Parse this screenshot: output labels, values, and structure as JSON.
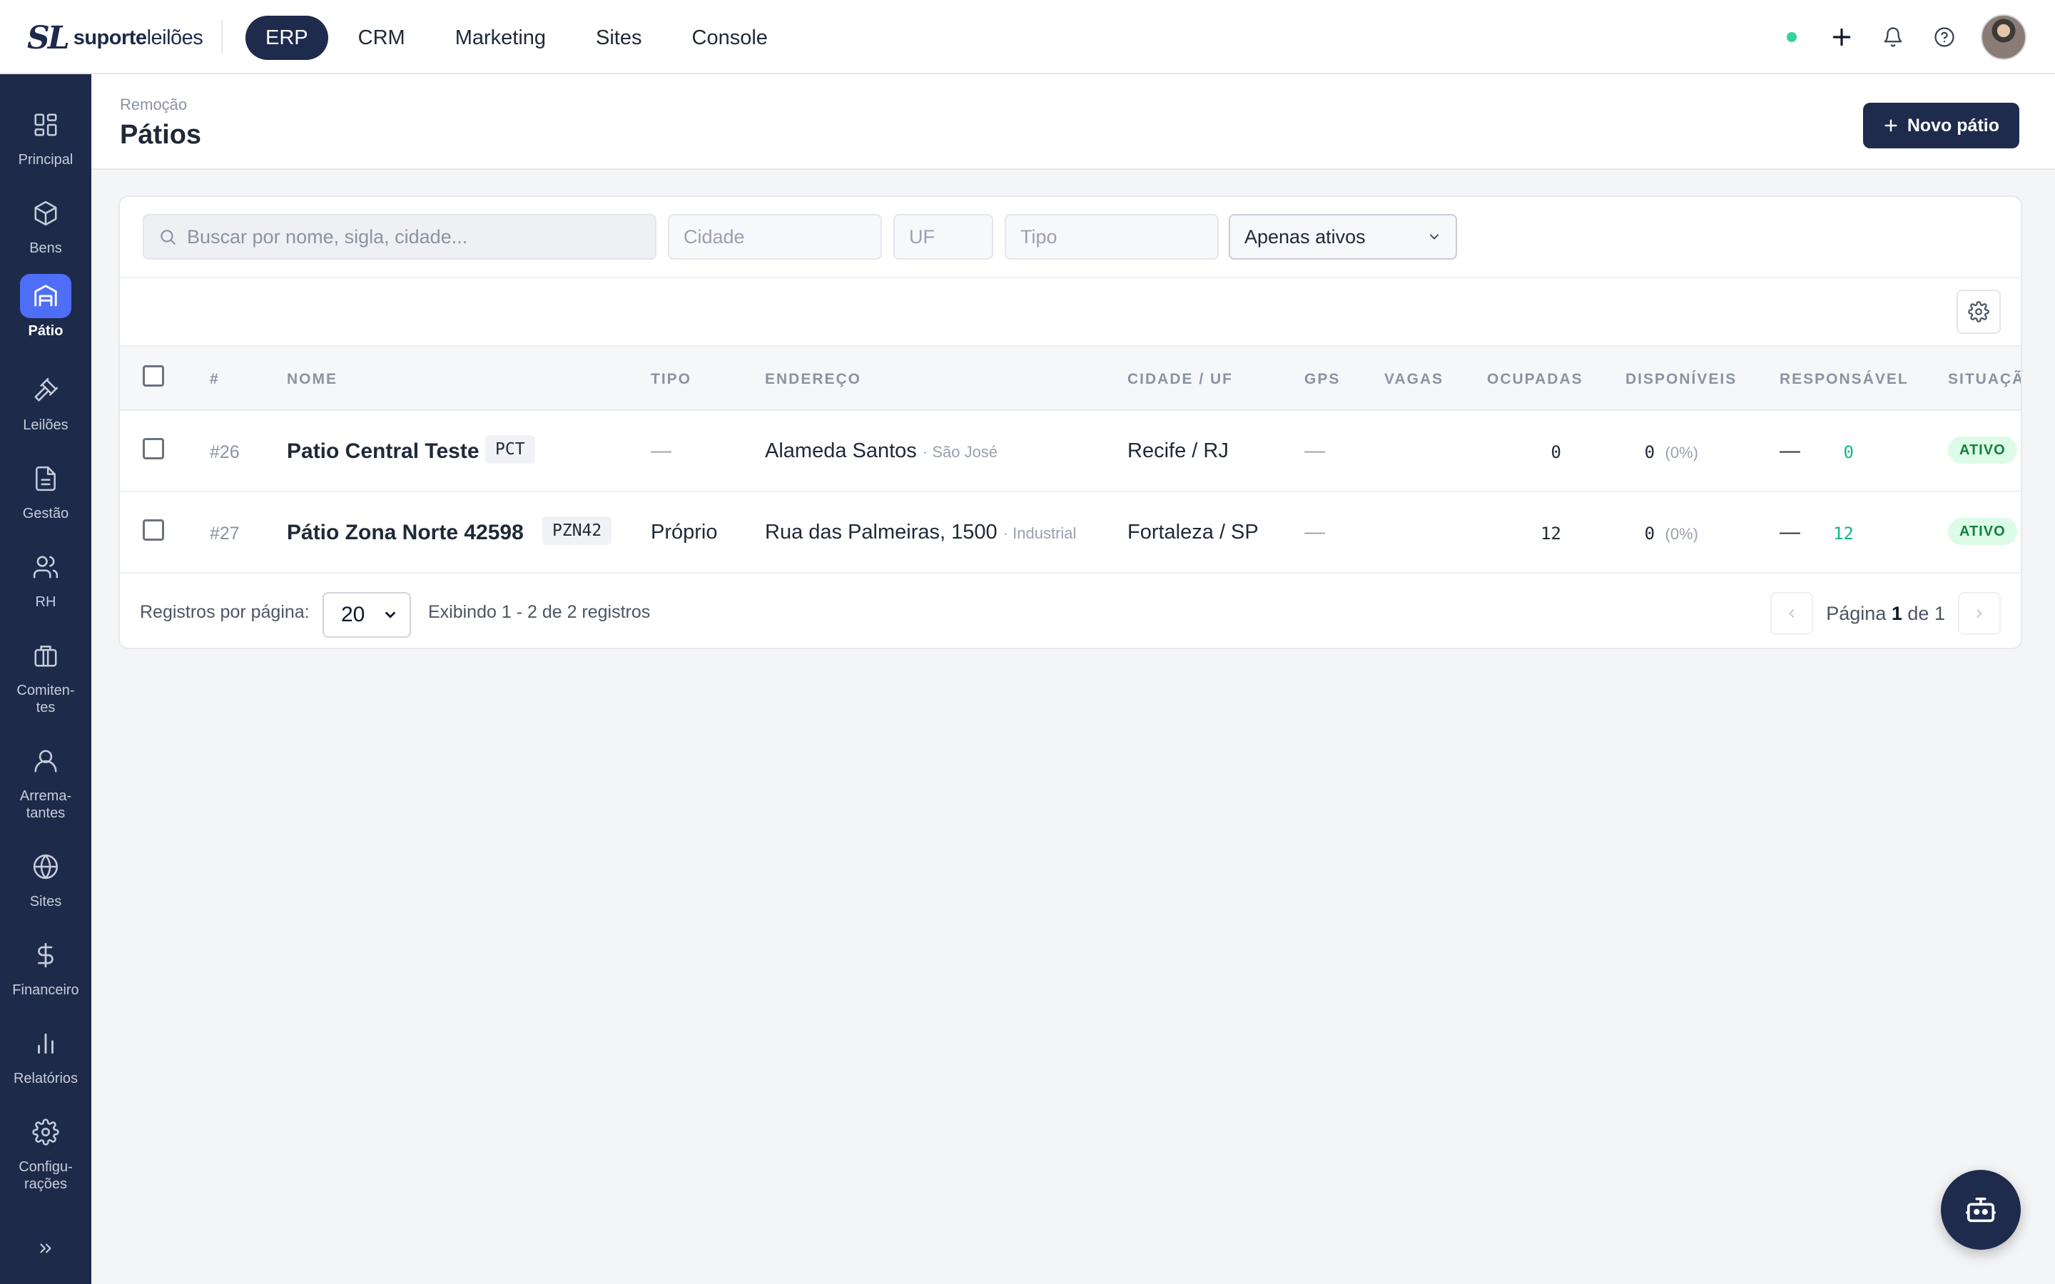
{
  "brand": {
    "mark": "SL",
    "name_bold": "suporte",
    "name_light": "leilões"
  },
  "modules": [
    {
      "label": "ERP",
      "active": true
    },
    {
      "label": "CRM"
    },
    {
      "label": "Marketing"
    },
    {
      "label": "Sites"
    },
    {
      "label": "Console"
    }
  ],
  "sidebar": {
    "items": [
      {
        "label": "Principal",
        "icon": "dashboard-icon"
      },
      {
        "label": "Bens",
        "icon": "box-icon"
      },
      {
        "label": "Pátio",
        "icon": "warehouse-icon",
        "active": true
      },
      {
        "label": "Leilões",
        "icon": "gavel-icon"
      },
      {
        "label": "Gestão",
        "icon": "document-icon"
      },
      {
        "label": "RH",
        "icon": "users-icon"
      },
      {
        "label": "Comiten-\ntes",
        "icon": "briefcase-icon"
      },
      {
        "label": "Arrema-\ntantes",
        "icon": "user-icon"
      },
      {
        "label": "Sites",
        "icon": "globe-icon"
      },
      {
        "label": "Financeiro",
        "icon": "dollar-icon"
      },
      {
        "label": "Relatórios",
        "icon": "bar-chart-icon"
      },
      {
        "label": "Configu-\nrações",
        "icon": "gear-icon"
      }
    ]
  },
  "page": {
    "breadcrumb": "Remoção",
    "title": "Pátios",
    "new_button": "Novo pátio"
  },
  "filters": {
    "search_placeholder": "Buscar por nome, sigla, cidade...",
    "city_placeholder": "Cidade",
    "uf_placeholder": "UF",
    "type_placeholder": "Tipo",
    "status_value": "Apenas ativos"
  },
  "table": {
    "headers": [
      "#",
      "NOME",
      "TIPO",
      "ENDEREÇO",
      "CIDADE / UF",
      "GPS",
      "VAGAS",
      "OCUPADAS",
      "DISPONÍVEIS",
      "RESPONSÁVEL",
      "SITUAÇÃO"
    ],
    "rows": [
      {
        "id": "#26",
        "name": "Patio Central Teste",
        "code": "PCT",
        "type": "—",
        "address": "Alameda Santos",
        "district": "· São José",
        "city": "Recife / RJ",
        "gps": "—",
        "spots": "0",
        "occupied": "0",
        "occupied_pct": "(0%)",
        "available": "0",
        "manager": "—",
        "status": "ATIVO"
      },
      {
        "id": "#27",
        "name": "Pátio Zona Norte 42598",
        "code": "PZN42",
        "type": "Próprio",
        "address": "Rua das Palmeiras, 1500",
        "district": "· Industrial",
        "city": "Fortaleza / SP",
        "gps": "—",
        "spots": "12",
        "occupied": "0",
        "occupied_pct": "(0%)",
        "available": "12",
        "manager": "—",
        "status": "ATIVO"
      }
    ]
  },
  "footer": {
    "per_page_label": "Registros por página:",
    "per_page_value": "20",
    "showing": "Exibindo 1 - 2 de 2 registros",
    "page_label": "Página",
    "page_current": "1",
    "page_of": "de",
    "page_total": "1"
  },
  "colors": {
    "navy": "#1e2a4a",
    "accent": "#4f6ef7",
    "success": "#10b981"
  }
}
